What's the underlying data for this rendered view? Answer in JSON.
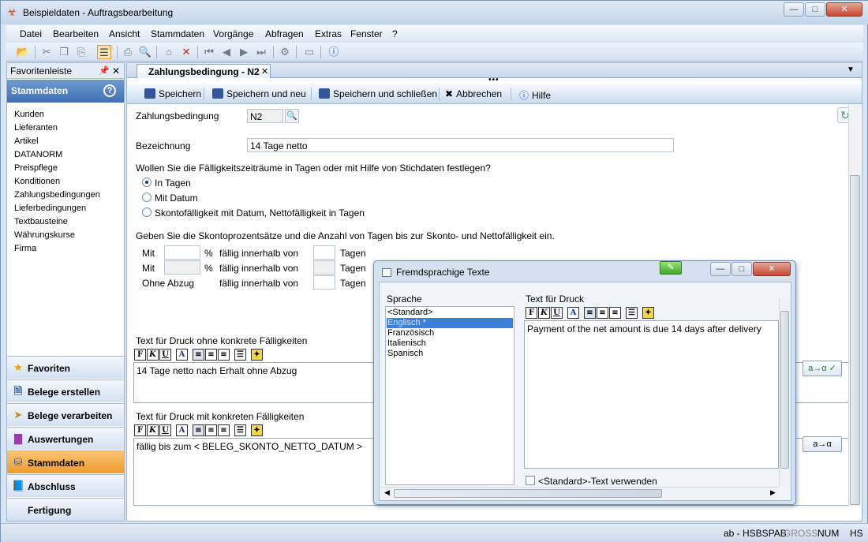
{
  "window": {
    "title": "Beispieldaten - Auftragsbearbeitung"
  },
  "menu": [
    "Datei",
    "Bearbeiten",
    "Ansicht",
    "Stammdaten",
    "Vorgänge",
    "Abfragen",
    "Extras",
    "Fenster",
    "?"
  ],
  "sidebar": {
    "header": "Favoritenleiste",
    "section_title": "Stammdaten",
    "items": [
      "Kunden",
      "Lieferanten",
      "Artikel",
      "DATANORM",
      "Preispflege",
      "Konditionen",
      "Zahlungsbedingungen",
      "Lieferbedingungen",
      "Textbausteine",
      "Währungskurse",
      "Firma"
    ],
    "nav": [
      "Favoriten",
      "Belege erstellen",
      "Belege verarbeiten",
      "Auswertungen",
      "Stammdaten",
      "Abschluss",
      "Fertigung"
    ]
  },
  "tab": {
    "label": "Zahlungsbedingung - N2"
  },
  "formbar": {
    "save": "Speichern",
    "save_new": "Speichern und neu",
    "save_close": "Speichern und schließen",
    "cancel": "Abbrechen",
    "help": "Hilfe"
  },
  "form": {
    "code_label": "Zahlungsbedingung",
    "code_value": "N2",
    "name_label": "Bezeichnung",
    "name_value": "14 Tage netto",
    "question": "Wollen Sie die Fälligkeitszeiträume in Tagen oder mit Hilfe von Stichdaten festlegen?",
    "radio_options": [
      "In Tagen",
      "Mit Datum",
      "Skontofälligkeit mit Datum, Nettofälligkeit in Tagen"
    ],
    "radio_selected": 0,
    "skonto_intro": "Geben Sie die Skontoprozentsätze und die Anzahl von Tagen bis zur Skonto- und Nettofälligkeit ein.",
    "rows": [
      {
        "prefix": "Mit",
        "percent": "%",
        "due": "fällig innerhalb von",
        "days": "Tagen"
      },
      {
        "prefix": "Mit",
        "percent": "%",
        "due": "fällig innerhalb von",
        "days": "Tagen"
      },
      {
        "prefix": "Ohne Abzug",
        "percent": "",
        "due": "fällig innerhalb von",
        "days": "Tagen"
      }
    ],
    "text1_label": "Text für Druck ohne konkrete Fälligkeiten",
    "text1_value": "14 Tage netto nach Erhalt ohne Abzug",
    "text2_label": "Text für Druck mit konkreten Fälligkeiten",
    "text2_value": "fällig bis zum < BELEG_SKONTO_NETTO_DATUM >",
    "fmt_buttons": [
      "F",
      "K",
      "U",
      "A"
    ]
  },
  "dialog": {
    "title": "Fremdsprachige Texte",
    "lang_label": "Sprache",
    "languages": [
      "<Standard>",
      "Englisch *",
      "Französisch",
      "Italienisch",
      "Spanisch"
    ],
    "selected_language": 1,
    "print_label": "Text für Druck",
    "print_text": "Payment of the net amount is due 14 days after delivery",
    "checkbox_label": "<Standard>-Text verwenden"
  },
  "translate_buttons": [
    "a→α ✓",
    "a→α"
  ],
  "status": {
    "user": "ab - HSBSPAB",
    "gross": "GROSS",
    "num": "NUM",
    "hs": "HS"
  }
}
